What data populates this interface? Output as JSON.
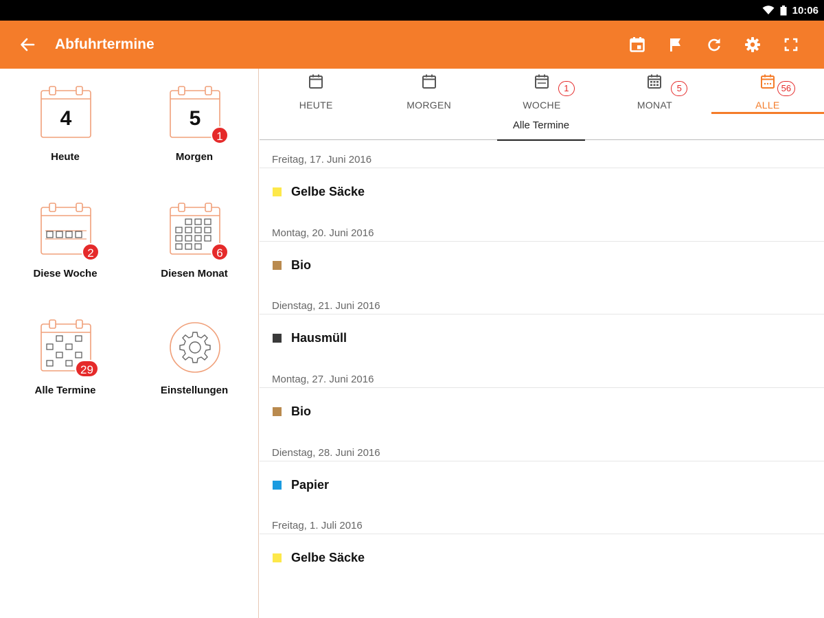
{
  "status_bar": {
    "time": "10:06"
  },
  "app_bar": {
    "title": "Abfuhrtermine",
    "actions": [
      "calendar-event-icon",
      "flag-icon",
      "refresh-icon",
      "settings-icon",
      "fullscreen-icon"
    ]
  },
  "colors": {
    "brand": "#f47c2a",
    "badge": "#e52a2a",
    "yellow": "#fde84a",
    "brown": "#b98a4e",
    "dark": "#3a3a3a",
    "blue": "#1a9be0"
  },
  "sidebar": {
    "tiles": [
      {
        "label": "Heute",
        "number": "4",
        "badge": ""
      },
      {
        "label": "Morgen",
        "number": "5",
        "badge": "1"
      },
      {
        "label": "Diese Woche",
        "badge": "2"
      },
      {
        "label": "Diesen Monat",
        "badge": "6"
      },
      {
        "label": "Alle Termine",
        "badge": "29"
      },
      {
        "label": "Einstellungen"
      }
    ]
  },
  "tabs": [
    {
      "label": "HEUTE",
      "badge": ""
    },
    {
      "label": "MORGEN",
      "badge": ""
    },
    {
      "label": "WOCHE",
      "badge": "1"
    },
    {
      "label": "MONAT",
      "badge": "5"
    },
    {
      "label": "ALLE",
      "badge": "56",
      "active": true
    }
  ],
  "subtab": {
    "label": "Alle Termine"
  },
  "events": [
    {
      "date": "Freitag, 17. Juni 2016",
      "name": "Gelbe Säcke",
      "color": "#fde84a"
    },
    {
      "date": "Montag, 20. Juni 2016",
      "name": "Bio",
      "color": "#b98a4e"
    },
    {
      "date": "Dienstag, 21. Juni 2016",
      "name": "Hausmüll",
      "color": "#3a3a3a"
    },
    {
      "date": "Montag, 27. Juni 2016",
      "name": "Bio",
      "color": "#b98a4e"
    },
    {
      "date": "Dienstag, 28. Juni 2016",
      "name": "Papier",
      "color": "#1a9be0"
    },
    {
      "date": "Freitag, 1. Juli 2016",
      "name": "Gelbe Säcke",
      "color": "#fde84a"
    }
  ]
}
